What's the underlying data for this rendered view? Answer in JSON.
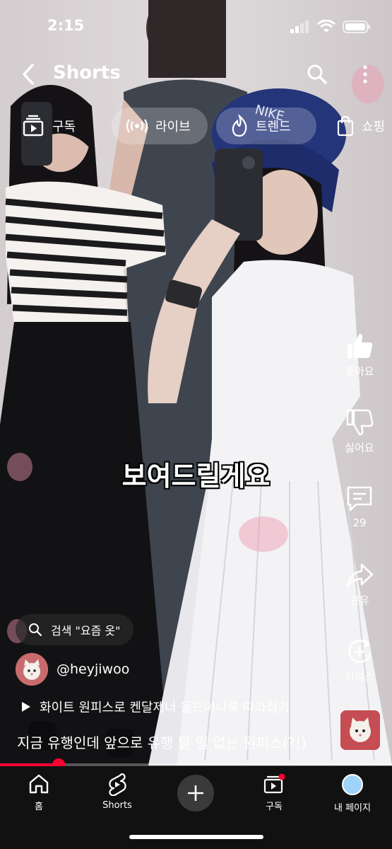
{
  "status_bar": {
    "time": "2:15"
  },
  "header": {
    "title": "Shorts",
    "back_icon": "chevron-left-icon",
    "search_icon": "search-icon",
    "more_icon": "more-vertical-icon"
  },
  "chips": [
    {
      "label": "구독",
      "icon": "subscriptions-icon"
    },
    {
      "label": "라이브",
      "icon": "live-broadcast-icon"
    },
    {
      "label": "트렌드",
      "icon": "trending-flame-icon"
    },
    {
      "label": "쇼핑",
      "icon": "shopping-bag-icon"
    }
  ],
  "rail": {
    "like": {
      "label": "좋아요",
      "icon": "thumbs-up-icon"
    },
    "dislike": {
      "label": "싫어요",
      "icon": "thumbs-down-icon"
    },
    "comments": {
      "label": "29",
      "icon": "comment-icon"
    },
    "share": {
      "label": "공유",
      "icon": "share-icon"
    },
    "remix": {
      "label": "리믹스",
      "icon": "remix-icon"
    }
  },
  "video_caption": "보여드릴게요",
  "search_suggestion": {
    "text": "검색 \"요즘 옷\"",
    "icon": "search-icon"
  },
  "channel": {
    "handle": "@heyjiwoo"
  },
  "playlist": {
    "title": "화이트 원피스로 켄달제너 올드머니룩 따라잡기",
    "icon": "play-icon"
  },
  "description": "지금 유행인데 앞으로 유행 탈 일 없는 원피스(?!)",
  "progress": {
    "fraction": 0.15
  },
  "bottom_nav": [
    {
      "label": "홈",
      "icon": "home-icon"
    },
    {
      "label": "Shorts",
      "icon": "shorts-icon"
    },
    {
      "label": "",
      "icon": "create-plus-icon"
    },
    {
      "label": "구독",
      "icon": "subscriptions-icon"
    },
    {
      "label": "내 페이지",
      "icon": "profile-avatar-icon"
    }
  ],
  "colors": {
    "accent": "#ff0033",
    "nav_bg": "#111111",
    "avatar_blue": "#9fd4f8"
  }
}
